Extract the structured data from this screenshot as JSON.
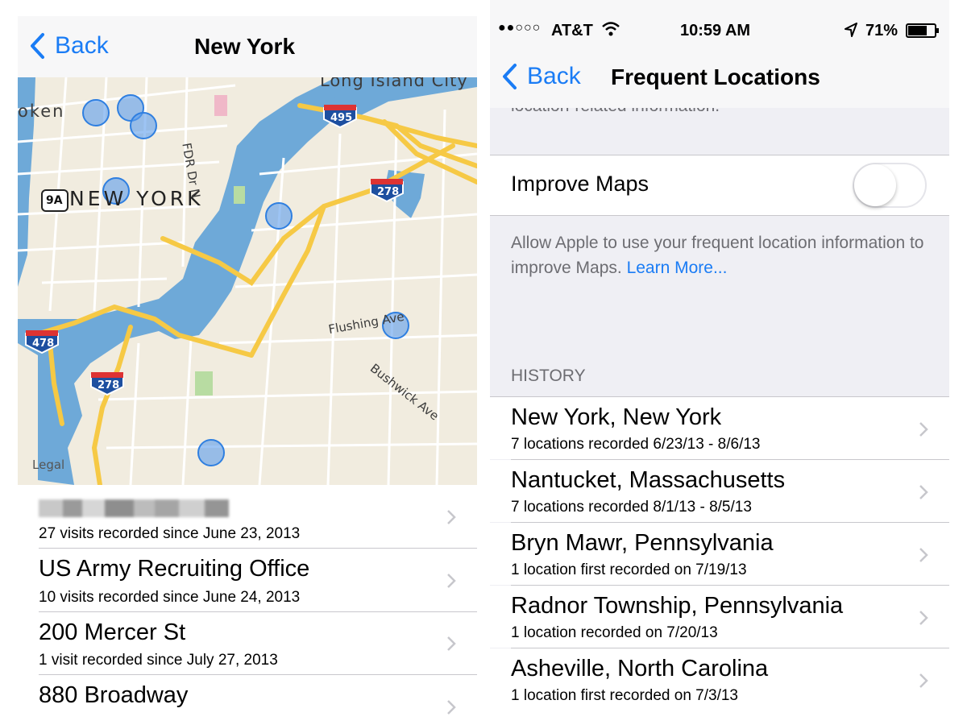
{
  "left_screen": {
    "nav": {
      "back_label": "Back",
      "title": "New York"
    },
    "map": {
      "labels": {
        "neighborhood_1": "Long Island City",
        "neighborhood_2": "oken",
        "city": "NEW YORK",
        "road_1": "FDR Dr N",
        "road_2": "Flushing Ave",
        "road_3": "Bushwick Ave",
        "legal": "Legal"
      },
      "shields": {
        "i495": "495",
        "i278_top": "278",
        "i478": "478",
        "i278_bottom": "278",
        "route_9a": "9A"
      },
      "colors": {
        "land": "#f1ecdf",
        "water": "#6ea9d8",
        "highway": "#f6c945",
        "road": "#ffffff",
        "pin": "#5b9ded"
      }
    },
    "list": [
      {
        "title": "",
        "title_redacted": true,
        "subtitle": "27 visits recorded since June 23, 2013"
      },
      {
        "title": "US Army Recruiting Office",
        "subtitle": "10 visits recorded since June 24, 2013"
      },
      {
        "title": "200 Mercer St",
        "subtitle": "1 visit recorded since July 27, 2013"
      },
      {
        "title": "880 Broadway",
        "subtitle": ""
      }
    ]
  },
  "right_screen": {
    "status_bar": {
      "carrier": "AT&T",
      "signal_dots": "●●○○○",
      "time": "10:59 AM",
      "battery": "71%"
    },
    "nav": {
      "back_label": "Back",
      "title": "Frequent Locations"
    },
    "clipped_text": "location-related information.",
    "improve_maps": {
      "label": "Improve Maps",
      "enabled": false
    },
    "footer": {
      "text": "Allow Apple to use your frequent location information to improve Maps.",
      "link": "Learn More..."
    },
    "history_header": "HISTORY",
    "history": [
      {
        "title": "New York, New York",
        "subtitle": "7 locations recorded 6/23/13 - 8/6/13"
      },
      {
        "title": "Nantucket, Massachusetts",
        "subtitle": "7 locations recorded 8/1/13 - 8/5/13"
      },
      {
        "title": "Bryn Mawr, Pennsylvania",
        "subtitle": "1 location first recorded on 7/19/13"
      },
      {
        "title": "Radnor Township, Pennsylvania",
        "subtitle": "1 location recorded on 7/20/13"
      },
      {
        "title": "Asheville, North Carolina",
        "subtitle": "1 location first recorded on 7/3/13"
      }
    ]
  }
}
